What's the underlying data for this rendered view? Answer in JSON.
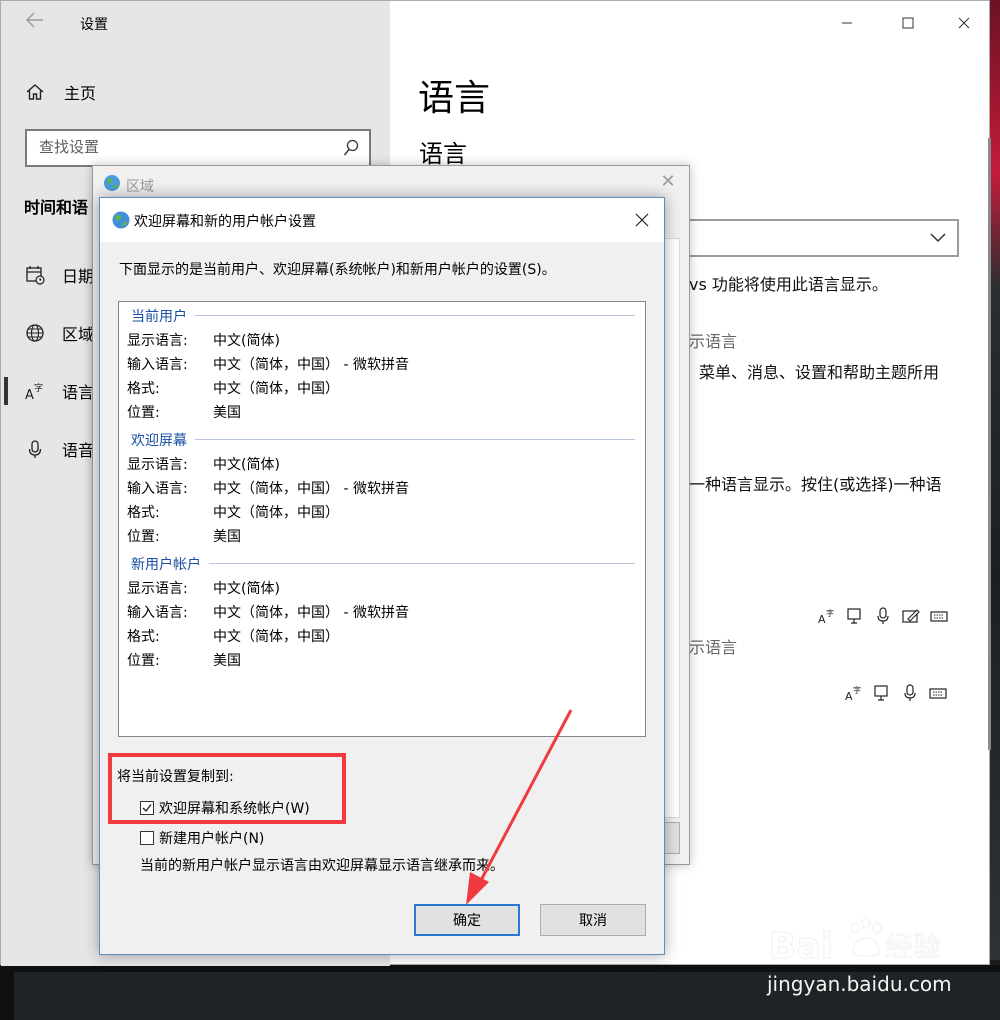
{
  "settings": {
    "title": "设置",
    "home_label": "主页",
    "search_placeholder": "查找设置",
    "nav_heading": "时间和语",
    "nav_items": [
      {
        "label": "日期"
      },
      {
        "label": "区域"
      },
      {
        "label": "语言"
      },
      {
        "label": "语音"
      }
    ],
    "content_title": "语言",
    "section_title": "语言",
    "bg_lines": {
      "l1": "vs 功能将使用此语言显示。",
      "l2": "示语言",
      "l3": "菜单、消息、设置和帮助主题所用",
      "l4": "一种语言显示。按住(或选择)一种语",
      "l5": "示语言"
    }
  },
  "region_dialog": {
    "title": "区域"
  },
  "dialog": {
    "title": "欢迎屏幕和新的用户帐户设置",
    "description": "下面显示的是当前用户、欢迎屏幕(系统帐户)和新用户帐户的设置(S)。",
    "sections": [
      {
        "heading": "当前用户",
        "rows": [
          {
            "label": "显示语言:",
            "value": "中文(简体)"
          },
          {
            "label": "输入语言:",
            "value": "中文（简体，中国） - 微软拼音"
          },
          {
            "label": "格式:",
            "value": "中文（简体，中国）"
          },
          {
            "label": "位置:",
            "value": "美国"
          }
        ]
      },
      {
        "heading": "欢迎屏幕",
        "rows": [
          {
            "label": "显示语言:",
            "value": "中文(简体)"
          },
          {
            "label": "输入语言:",
            "value": "中文（简体，中国） - 微软拼音"
          },
          {
            "label": "格式:",
            "value": "中文（简体，中国）"
          },
          {
            "label": "位置:",
            "value": "美国"
          }
        ]
      },
      {
        "heading": "新用户帐户",
        "rows": [
          {
            "label": "显示语言:",
            "value": "中文(简体)"
          },
          {
            "label": "输入语言:",
            "value": "中文（简体，中国） - 微软拼音"
          },
          {
            "label": "格式:",
            "value": "中文（简体，中国）"
          },
          {
            "label": "位置:",
            "value": "美国"
          }
        ]
      }
    ],
    "copy_label": "将当前设置复制到:",
    "checkboxes": [
      {
        "label": "欢迎屏幕和系统帐户(W)",
        "checked": true
      },
      {
        "label": "新建用户帐户(N)",
        "checked": false
      }
    ],
    "note": "当前的新用户帐户显示语言由欢迎屏幕显示语言继承而来。",
    "ok_label": "确定",
    "cancel_label": "取消"
  },
  "watermark": {
    "logo_text": "Bai 经验",
    "url": "jingyan.baidu.com"
  },
  "colors": {
    "annotation_red": "#f03a3f",
    "section_blue": "#1a4fa3",
    "focus_blue": "#2a78d1"
  }
}
